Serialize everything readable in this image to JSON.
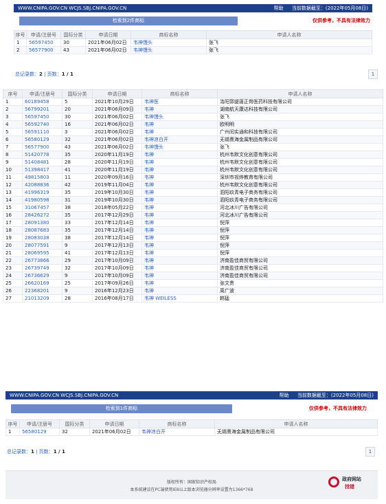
{
  "top1": {
    "urls": "WWW.CNIPA.GOV.CN WCJS.SBJ.CNIPA.GOV.CN",
    "help": "帮助",
    "date": "当前数据截至：(2022年05月08日)",
    "result_label": "检索到2件商标",
    "disclaimer": "仅供参考，不具有法律效力",
    "headers": [
      "序号",
      "申请/注册号",
      "国际分类",
      "申请日期",
      "商标名称",
      "申请人名称"
    ],
    "rows": [
      [
        "1",
        "56597450",
        "30",
        "2021年06月02日",
        "韦神馒头",
        "张飞"
      ],
      [
        "2",
        "56577900",
        "43",
        "2021年06月02日",
        "韦神馒头",
        "张飞"
      ]
    ],
    "pager_prefix": "总记录数：",
    "pager_total": "2",
    "pager_mid": " | 页数：",
    "pager_pages": "1 / 1",
    "page_btn": "1"
  },
  "main": {
    "headers": [
      "序号",
      "申请/注册号",
      "国际分类",
      "申请日期",
      "商标名称",
      "申请人名称"
    ],
    "rows": [
      [
        "1",
        "60189458",
        "5",
        "2021年10月29日",
        "韦神医",
        "洛阳郭缇唐正骨医药科技有限公司"
      ],
      [
        "2",
        "56799201",
        "20",
        "2021年06月09日",
        "韦神",
        "湖南航天康达科技有限公司"
      ],
      [
        "3",
        "56597450",
        "30",
        "2021年06月02日",
        "韦神馒头",
        "张飞"
      ],
      [
        "4",
        "56592740",
        "16",
        "2021年06月02日",
        "韦神",
        "欧明明"
      ],
      [
        "5",
        "56591110",
        "3",
        "2021年06月02日",
        "韦神",
        "广州闰实通和科技有限公司"
      ],
      [
        "6",
        "56580129",
        "32",
        "2021年06月02日",
        "韦神凉白开",
        "无锡熹海金属制品有限公司"
      ],
      [
        "7",
        "56577900",
        "43",
        "2021年06月02日",
        "韦神馒头",
        "张飞"
      ],
      [
        "8",
        "51420778",
        "35",
        "2020年11月19日",
        "韦神",
        "杭州韦默文化创意有限公司"
      ],
      [
        "9",
        "51408481",
        "28",
        "2020年11月19日",
        "韦神",
        "杭州韦默文化创意有限公司"
      ],
      [
        "10",
        "51398417",
        "41",
        "2020年11月19日",
        "韦神",
        "杭州韦默文化创意有限公司"
      ],
      [
        "11",
        "49815803",
        "11",
        "2020年09月16日",
        "韦神",
        "深圳市视烨教育有限公司"
      ],
      [
        "12",
        "42088836",
        "42",
        "2019年11月04日",
        "韦神",
        "杭州韦默文化创意有限公司"
      ],
      [
        "13",
        "41996319",
        "35",
        "2019年10月30日",
        "韦神",
        "泗阳玖青电子商务有限公司"
      ],
      [
        "14",
        "41980598",
        "31",
        "2019年10月30日",
        "韦神",
        "泗阳玖青电子商务有限公司"
      ],
      [
        "15",
        "31067457",
        "38",
        "2018年05月22日",
        "韦神",
        "河北冰川广告有限公司"
      ],
      [
        "16",
        "28426272",
        "35",
        "2017年12月29日",
        "韦神",
        "河北冰川广告有限公司"
      ],
      [
        "17",
        "28091380",
        "33",
        "2017年12月14日",
        "韦神",
        "倪萍"
      ],
      [
        "18",
        "28087683",
        "35",
        "2017年12月14日",
        "韦神",
        "倪萍"
      ],
      [
        "19",
        "28083038",
        "38",
        "2017年12月14日",
        "韦神",
        "倪萍"
      ],
      [
        "20",
        "28077591",
        "9",
        "2017年12月13日",
        "韦神",
        "倪萍"
      ],
      [
        "21",
        "28069595",
        "41",
        "2017年12月13日",
        "韦神",
        "倪萍"
      ],
      [
        "22",
        "26773866",
        "29",
        "2017年10月09日",
        "韦神",
        "济南盈佳商贸有限公司"
      ],
      [
        "23",
        "26739749",
        "32",
        "2017年10月09日",
        "韦神",
        "济南盈佳商贸有限公司"
      ],
      [
        "24",
        "26736629",
        "9",
        "2017年10月09日",
        "韦神",
        "济南盈佳商贸有限公司"
      ],
      [
        "25",
        "26620169",
        "25",
        "2017年09月26日",
        "韦神",
        "张文贵"
      ],
      [
        "26",
        "22368201",
        "9",
        "2016年12月23日",
        "韦神",
        "周广波"
      ],
      [
        "27",
        "21013209",
        "28",
        "2016年08月17日",
        "韦神 WEILESS",
        "韩猛"
      ]
    ]
  },
  "top2": {
    "urls": "WWW.CNIPA.GOV.CN WCJS.SBJ.CNIPA.GOV.CN",
    "help": "帮助",
    "date": "当前数据截至：(2022年05月08日)",
    "result_label": "检索到1件商标",
    "disclaimer": "仅供参考，不具有法律效力",
    "headers": [
      "序号",
      "申请/注册号",
      "国际分类",
      "申请日期",
      "商标名称",
      "申请人名称"
    ],
    "rows": [
      [
        "1",
        "56580129",
        "32",
        "2021年06月02日",
        "韦神凉白开",
        "无锡熹海金属制品有限公司"
      ]
    ],
    "pager_prefix": "总记录数：",
    "pager_total": "1",
    "pager_mid": " | 页数：",
    "pager_pages": "1 / 1",
    "page_btn": "1"
  },
  "footer": {
    "line1": "版权所有：国家知识产权局",
    "line2": "本系统建议在PC端使用IE8以上版本浏览器分辨率设置为1366*768",
    "gov_title": "政府网站",
    "gov_sub": "找错"
  }
}
